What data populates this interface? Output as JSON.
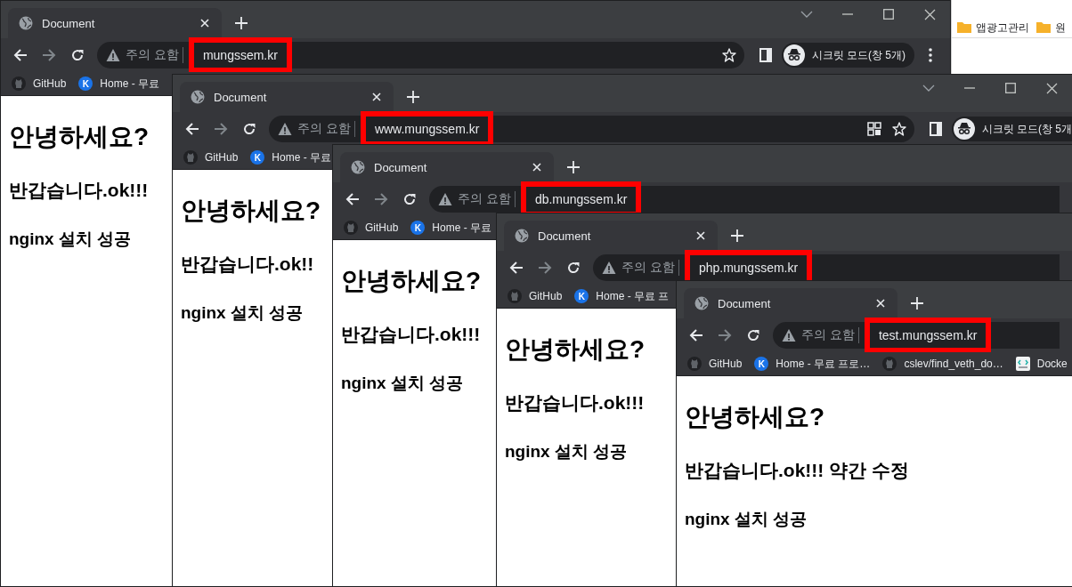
{
  "background_window": {
    "bookmarks": [
      {
        "label": "앱광고관리"
      },
      {
        "label": "원"
      }
    ]
  },
  "windows": [
    {
      "tab_title": "Document",
      "window_controls": true,
      "security_label": "주의 요함",
      "url": "mungssem.kr",
      "url_highlighted": true,
      "star": true,
      "incognito_label": "시크릿 모드(창 5개)",
      "menu": true,
      "bookmarks": [
        {
          "kind": "github",
          "label": "GitHub"
        },
        {
          "kind": "letter",
          "icon_text": "K",
          "label": "Home - 무료"
        }
      ],
      "headings": [
        "안녕하세요?",
        "반갑습니다.ok!!!",
        "nginx 설치 성공"
      ]
    },
    {
      "tab_title": "Document",
      "window_controls": true,
      "security_label": "주의 요함",
      "url": "www.mungssem.kr",
      "url_highlighted": true,
      "install_icon": true,
      "star": true,
      "incognito_label": "시크릿 모드(창 5개",
      "bookmarks": [
        {
          "kind": "github",
          "label": "GitHub"
        },
        {
          "kind": "letter",
          "icon_text": "K",
          "label": "Home - 무료"
        }
      ],
      "headings": [
        "안녕하세요?",
        "반갑습니다.ok!!",
        "nginx 설치 성공"
      ]
    },
    {
      "tab_title": "Document",
      "security_label": "주의 요함",
      "url": "db.mungssem.kr",
      "url_highlighted": true,
      "bookmarks": [
        {
          "kind": "github",
          "label": "GitHub"
        },
        {
          "kind": "letter",
          "icon_text": "K",
          "label": "Home - 무료"
        }
      ],
      "headings": [
        "안녕하세요?",
        "반갑습니다.ok!!!",
        "nginx 설치 성공"
      ]
    },
    {
      "tab_title": "Document",
      "security_label": "주의 요함",
      "url": "php.mungssem.kr",
      "url_highlighted": true,
      "bookmarks": [
        {
          "kind": "github",
          "label": "GitHub"
        },
        {
          "kind": "letter",
          "icon_text": "K",
          "label": "Home - 무료 프"
        }
      ],
      "headings": [
        "안녕하세요?",
        "반갑습니다.ok!!!",
        "nginx 설치 성공"
      ]
    },
    {
      "tab_title": "Document",
      "security_label": "주의 요함",
      "url": "test.mungssem.kr",
      "url_highlighted": true,
      "bookmarks": [
        {
          "kind": "github",
          "label": "GitHub"
        },
        {
          "kind": "letter",
          "icon_text": "K",
          "label": "Home - 무료 프로…"
        },
        {
          "kind": "github",
          "label": "cslev/find_veth_do…"
        },
        {
          "kind": "app",
          "label": "Docke"
        }
      ],
      "headings": [
        "안녕하세요?",
        "반갑습니다.ok!!! 약간 수정",
        "nginx 설치 성공"
      ]
    }
  ]
}
